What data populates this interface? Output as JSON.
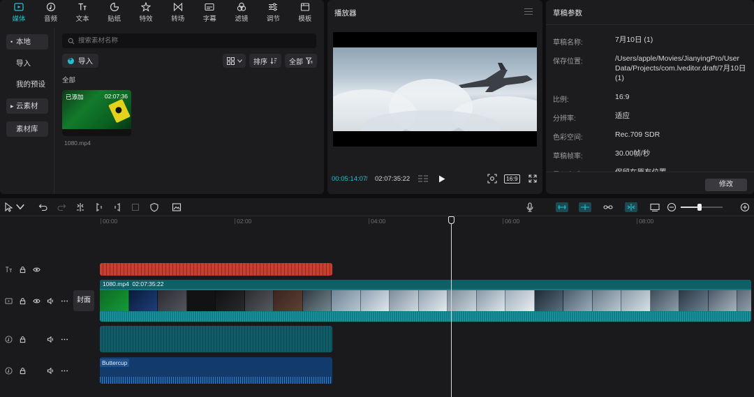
{
  "media_tabs": [
    {
      "label": "媒体",
      "icon": "media-icon",
      "active": true
    },
    {
      "label": "音频",
      "icon": "audio-icon"
    },
    {
      "label": "文本",
      "icon": "text-icon"
    },
    {
      "label": "贴纸",
      "icon": "sticker-icon"
    },
    {
      "label": "特效",
      "icon": "effects-icon"
    },
    {
      "label": "转场",
      "icon": "transition-icon"
    },
    {
      "label": "字幕",
      "icon": "subtitle-icon"
    },
    {
      "label": "滤镜",
      "icon": "filter-icon"
    },
    {
      "label": "调节",
      "icon": "adjust-icon"
    },
    {
      "label": "模板",
      "icon": "template-icon"
    }
  ],
  "sidebar": {
    "local": "本地",
    "import": "导入",
    "presets": "我的预设",
    "cloud": "云素材",
    "library": "素材库"
  },
  "search": {
    "placeholder": "搜索素材名称"
  },
  "import_button": "导入",
  "sort_label": "排序",
  "filter_label": "全部",
  "group_label": "全部",
  "media_item": {
    "badge": "已添加",
    "duration": "02:07:36",
    "file": "1080.mp4"
  },
  "player": {
    "title": "播放器",
    "current_time": "00:05:14:07",
    "separator": "/",
    "total_time": "02:07:35:22",
    "ratio": "16:9"
  },
  "props": {
    "title": "草稿参数",
    "rows": [
      {
        "label": "草稿名称:",
        "value": "7月10日 (1)"
      },
      {
        "label": "保存位置:",
        "value": "/Users/apple/Movies/JianyingPro/User Data/Projects/com.lveditor.draft/7月10日 (1)"
      },
      {
        "label": "比例:",
        "value": "16:9"
      },
      {
        "label": "分辨率:",
        "value": "适应"
      },
      {
        "label": "色彩空间:",
        "value": "Rec.709 SDR"
      },
      {
        "label": "草稿帧率:",
        "value": "30.00帧/秒"
      },
      {
        "label": "导入方式:",
        "value": "保留在原有位置"
      }
    ],
    "edit_button": "修改"
  },
  "timeline": {
    "ruler": [
      "00:00",
      "02:00",
      "04:00",
      "06:00",
      "08:00"
    ],
    "cover_label": "封面",
    "video_clip_name": "1080.mp4",
    "video_clip_duration": "02:07:35:22",
    "audio_clip_name": "Buttercup",
    "zoom_level": 0.45
  },
  "colors": {
    "accent": "#22c1d1",
    "text_clip": "#c7402f",
    "video_clip": "#137b83",
    "audio_clip": "#123a6a"
  }
}
